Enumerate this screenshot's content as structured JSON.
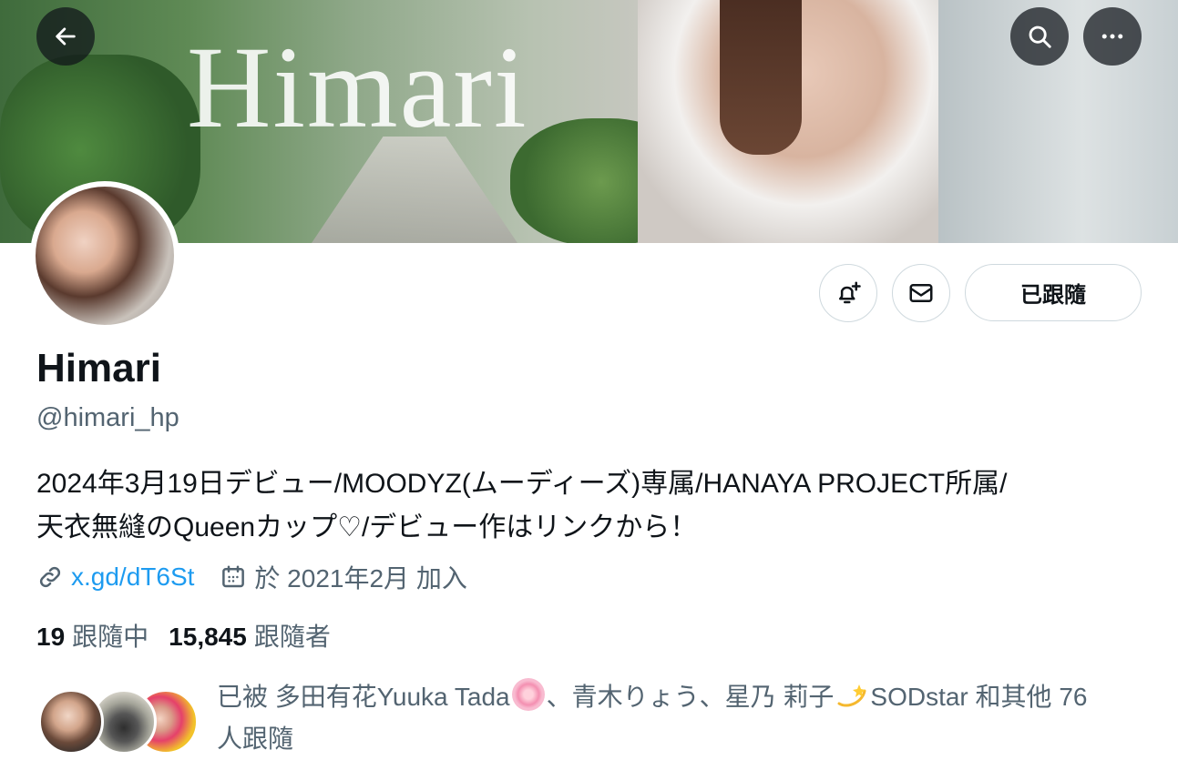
{
  "banner": {
    "title": "Himari"
  },
  "header_actions": {
    "back_icon": "arrow-left-icon",
    "search_icon": "search-icon",
    "more_icon": "more-horizontal-icon"
  },
  "profile_actions": {
    "notify_icon": "bell-plus-icon",
    "message_icon": "mail-icon",
    "follow_label": "已跟隨"
  },
  "profile": {
    "name": "Himari",
    "handle": "@himari_hp",
    "bio_line1": "2024年3月19日デビュー/MOODYZ(ムーディーズ)専属/HANAYA PROJECT所属/",
    "bio_line2": "天衣無縫のQueenカップ♡/デビュー作はリンクから！",
    "link": "x.gd/dT6St",
    "joined": "於 2021年2月 加入"
  },
  "stats": {
    "following_count": "19",
    "following_label": "跟隨中",
    "followers_count": "15,845",
    "followers_label": "跟隨者"
  },
  "followed_by": {
    "prefix": "已被 ",
    "name1": "多田有花Yuuka Tada",
    "sep1": "、青木りょう、星乃 莉子",
    "name3_suffix": "SODstar 和其他 76",
    "line2": "人跟隨"
  },
  "colors": {
    "accent": "#1d9bf0",
    "text": "#0f1419",
    "muted": "#536471",
    "border": "#cfd9de"
  }
}
